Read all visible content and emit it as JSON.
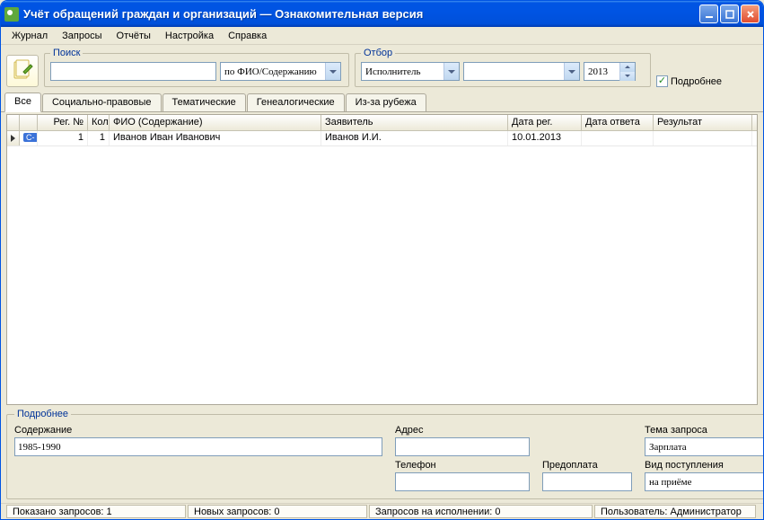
{
  "title": "Учёт обращений граждан и организаций — Ознакомительная версия",
  "menu": [
    "Журнал",
    "Запросы",
    "Отчёты",
    "Настройка",
    "Справка"
  ],
  "search": {
    "legend": "Поиск",
    "value": "",
    "type_selected": "по ФИО/Содержанию"
  },
  "filter": {
    "legend": "Отбор",
    "by_selected": "Исполнитель",
    "value": "",
    "year": "2013"
  },
  "more_chk": {
    "label": "Подробнее",
    "checked": true
  },
  "tabs": [
    "Все",
    "Социально-правовые",
    "Тематические",
    "Генеалогические",
    "Из-за рубежа"
  ],
  "active_tab": 0,
  "grid_headers": [
    "",
    "Рег. №",
    "Кол",
    "ФИО (Содержание)",
    "Заявитель",
    "Дата рег.",
    "Дата ответа",
    "Результат"
  ],
  "rows": [
    {
      "badge": "С-",
      "reg": "1",
      "kol": "1",
      "fio": "Иванов Иван Иванович",
      "decl": "Иванов И.И.",
      "date_reg": "10.01.2013",
      "date_ans": "",
      "result": ""
    }
  ],
  "details": {
    "legend": "Подробнее",
    "content_label": "Содержание",
    "content_value": "1985-1990",
    "address_label": "Адрес",
    "address_value": "",
    "phone_label": "Телефон",
    "phone_value": "",
    "prepay_label": "Предоплата",
    "prepay_value": "",
    "topic_label": "Тема запроса",
    "topic_value": "Зарплата",
    "kind_label": "Вид поступления",
    "kind_value": "на приёме"
  },
  "status": {
    "shown": "Показано запросов: 1",
    "new": "Новых запросов: 0",
    "pending": "Запросов на исполнении: 0",
    "user": "Пользователь: Администратор"
  }
}
